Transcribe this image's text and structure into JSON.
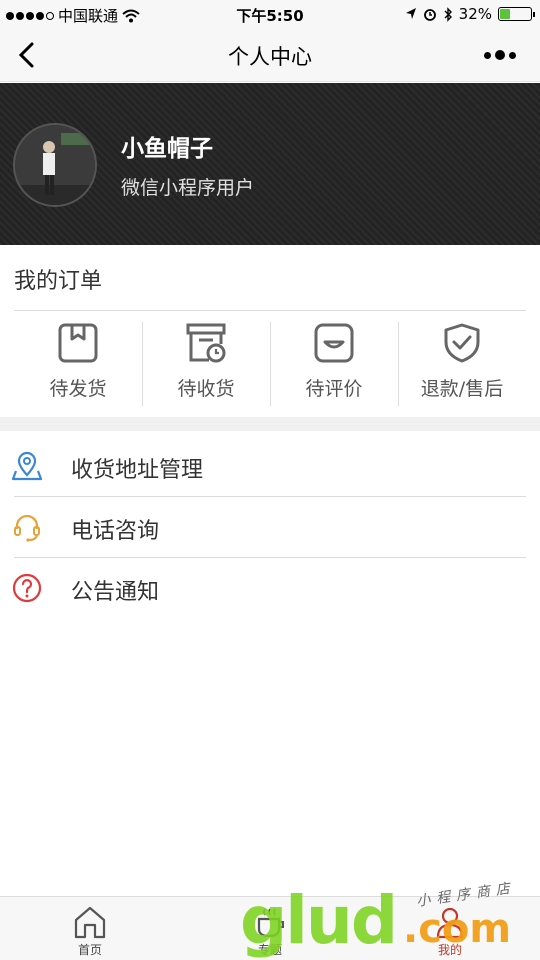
{
  "status_bar": {
    "carrier": "中国联通",
    "time": "下午5:50",
    "battery_percent": "32%",
    "battery_level": 0.32
  },
  "nav": {
    "title": "个人中心"
  },
  "profile": {
    "username": "小鱼帽子",
    "user_tag": "微信小程序用户"
  },
  "orders": {
    "title": "我的订单",
    "items": [
      {
        "label": "待发货",
        "icon": "box-icon"
      },
      {
        "label": "待收货",
        "icon": "delivery-clock-icon"
      },
      {
        "label": "待评价",
        "icon": "smile-icon"
      },
      {
        "label": "退款/售后",
        "icon": "shield-check-icon"
      }
    ]
  },
  "menu": {
    "items": [
      {
        "label": "收货地址管理",
        "icon": "location-map-icon",
        "color": "#3a86d8"
      },
      {
        "label": "电话咨询",
        "icon": "headset-icon",
        "color": "#e8a23a"
      },
      {
        "label": "公告通知",
        "icon": "question-icon",
        "color": "#e03b3b"
      }
    ]
  },
  "tabbar": {
    "items": [
      {
        "label": "首页",
        "icon": "home-icon"
      },
      {
        "label": "专题",
        "icon": "coffee-cup-icon"
      },
      {
        "label": "我的",
        "icon": "user-icon",
        "active": true
      }
    ]
  },
  "watermark": {
    "brand": "glud",
    "suffix": ".com",
    "tagline": "小程序商店"
  },
  "colors": {
    "accent_active": "#c0392b",
    "header_bg": "#2a2a2a",
    "icon_gray": "#666666"
  }
}
